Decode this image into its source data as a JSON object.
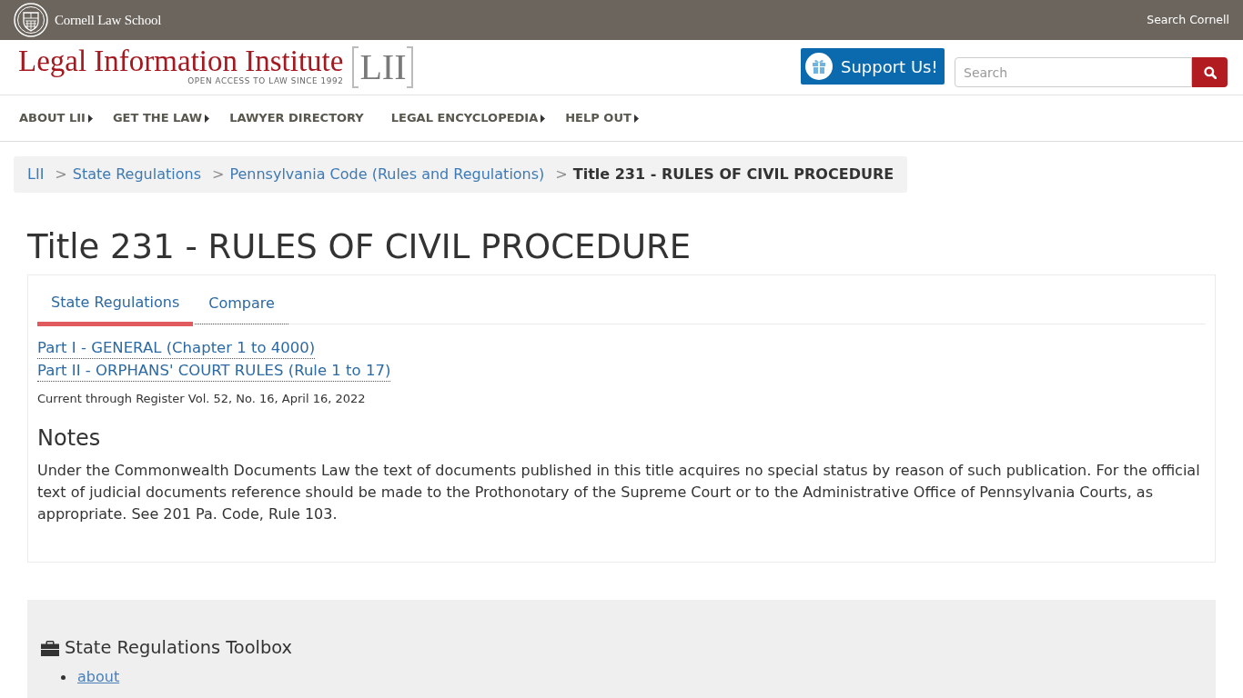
{
  "top_bar": {
    "school": "Cornell Law School",
    "search_link": "Search Cornell"
  },
  "header": {
    "logo_title": "Legal Information Institute",
    "logo_tagline": "OPEN ACCESS TO LAW SINCE 1992",
    "logo_mark": "LII",
    "support_button": "Support Us!",
    "search": {
      "placeholder": "Search"
    }
  },
  "nav": [
    {
      "label": "ABOUT LII",
      "has_menu": true
    },
    {
      "label": "GET THE LAW",
      "has_menu": true
    },
    {
      "label": "LAWYER DIRECTORY",
      "has_menu": false
    },
    {
      "label": "LEGAL ENCYCLOPEDIA",
      "has_menu": true
    },
    {
      "label": "HELP OUT",
      "has_menu": true
    }
  ],
  "breadcrumb": [
    {
      "label": "LII",
      "current": false
    },
    {
      "separator": ">",
      "label": "State Regulations",
      "current": false
    },
    {
      "separator": ">",
      "label": "Pennsylvania Code (Rules and Regulations)",
      "current": false
    },
    {
      "separator": ">",
      "label": "Title 231 - RULES OF CIVIL PROCEDURE",
      "current": true
    }
  ],
  "page_title": "Title 231 - RULES OF CIVIL PROCEDURE",
  "tabs": [
    {
      "label": "State Regulations",
      "selected": true
    },
    {
      "label": "Compare",
      "selected": false
    }
  ],
  "parts": [
    "Part I - GENERAL (Chapter 1 to 4000)",
    "Part II - ORPHANS' COURT RULES (Rule 1 to 17)"
  ],
  "currency_note": "Current through Register Vol. 52, No. 16, April 16, 2022",
  "notes": {
    "heading": "Notes",
    "text": "Under the Commonwealth Documents Law the text of documents published in this title acquires no special status by reason of such publication. For the official text of judicial documents reference should be made to the Prothonotary of the Supreme Court or to the Administrative Office of Pennsylvania Courts, as appropriate. See 201 Pa. Code, Rule 103."
  },
  "toolbox": {
    "title": "State Regulations Toolbox",
    "links": [
      "about"
    ]
  }
}
